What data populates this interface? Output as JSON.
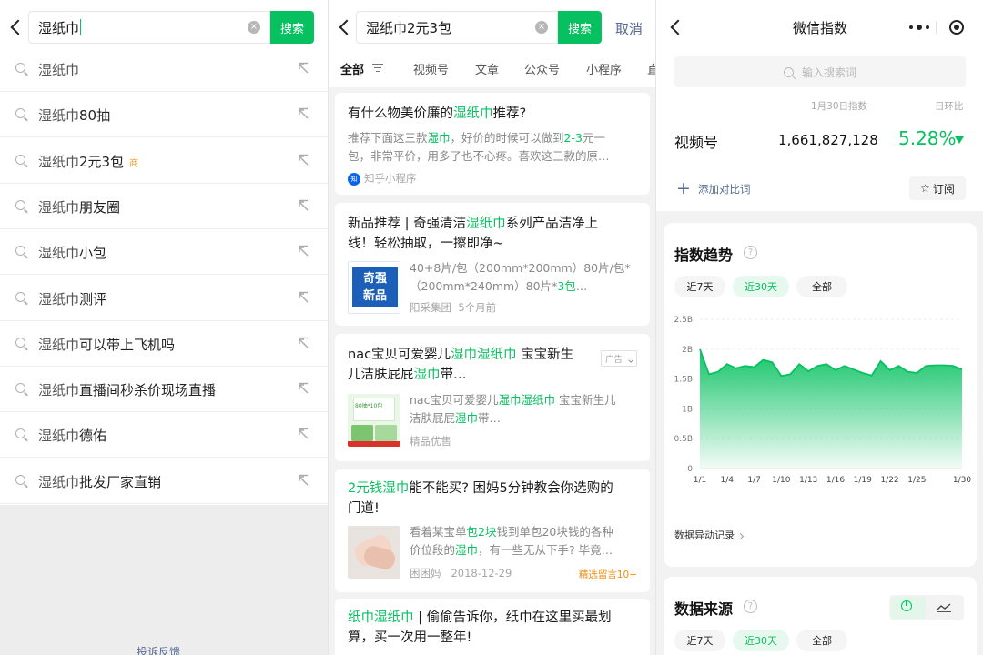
{
  "panel1": {
    "query": "湿纸巾",
    "search_btn": "搜索",
    "clear_icon": "×",
    "suggestions": [
      {
        "prefix": "湿纸巾",
        "rest": ""
      },
      {
        "prefix": "湿纸巾",
        "rest": "80抽"
      },
      {
        "prefix": "湿纸巾",
        "rest": "2元3包",
        "tag": "商"
      },
      {
        "prefix": "湿纸巾",
        "rest": "朋友圈"
      },
      {
        "prefix": "湿纸巾",
        "rest": "小包"
      },
      {
        "prefix": "湿纸巾",
        "rest": "测评"
      },
      {
        "prefix": "湿纸巾",
        "rest": "可以带上飞机吗"
      },
      {
        "prefix": "湿纸巾",
        "rest": "直播间秒杀价现场直播"
      },
      {
        "prefix": "湿纸巾",
        "rest": "德佑"
      },
      {
        "prefix": "湿纸巾",
        "rest": "批发厂家直销"
      }
    ],
    "feedback": "投诉反馈"
  },
  "panel2": {
    "query": "湿纸巾2元3包",
    "search_btn": "搜索",
    "cancel": "取消",
    "clear_icon": "×",
    "tabs": [
      "全部",
      "视频号",
      "文章",
      "公众号",
      "小程序",
      "直"
    ],
    "cards": [
      {
        "title_parts": [
          "有什么物美价廉的",
          "湿纸巾",
          "推荐?"
        ],
        "desc_parts": [
          "推荐下面这三款",
          "湿巾",
          "，好价的时候可以做到",
          "2-3",
          "元一"
        ],
        "desc_line2": "包，非常平价，用多了也不心疼。喜欢这三款的原…",
        "source_badge": "知",
        "source": "知乎小程序"
      },
      {
        "title_parts": [
          "新品推荐 | 奇强清洁",
          "湿纸巾",
          "系列产品洁净上"
        ],
        "title_line2": "线！轻松抽取，一擦即净~",
        "thumb_text": [
          "奇强",
          "新品"
        ],
        "desc_line1": "40+8片/包（200mm*200mm）80片/包*",
        "desc_parts2": [
          "（200mm*240mm）80片*",
          "3包",
          "…"
        ],
        "source": "阳采集团",
        "time": "5个月前"
      },
      {
        "title_parts": [
          "nac宝贝可爱婴儿",
          "湿巾湿纸巾",
          " 宝宝新生"
        ],
        "title_parts2": [
          "儿洁肤屁屁",
          "湿巾",
          "带…"
        ],
        "ad": "广告",
        "thumb_text": [
          "80抽*10包"
        ],
        "desc_parts": [
          "nac宝贝可爱婴儿",
          "湿巾湿纸巾",
          " 宝宝新生儿"
        ],
        "desc_parts2": [
          "洁肤屁屁",
          "湿巾",
          "带…"
        ],
        "source": "精品优售"
      },
      {
        "title_parts": [
          "2元钱湿巾",
          "能不能买? 困妈5分钟教会你选购的"
        ],
        "title_line2": "门道!",
        "desc_parts": [
          "看着某宝单",
          "包2块",
          "钱到单包20块钱的各种"
        ],
        "desc_parts2": [
          "价位段的",
          "湿巾",
          "，有一些无从下手? 毕竟…"
        ],
        "source": "困困妈",
        "time": "2018-12-29",
        "comment": "精选留言10+"
      },
      {
        "title_parts": [
          "纸巾湿纸巾",
          " | 偷偷告诉你，纸巾在这里买最划"
        ],
        "title_line2": "算，买一次用一整年!"
      }
    ]
  },
  "panel3": {
    "title": "微信指数",
    "search_placeholder": "输入搜索词",
    "date_label": "1月30日指数",
    "dod_label": "日环比",
    "metric_name": "视频号",
    "metric_value": "1,661,827,128",
    "metric_pct": "5.28%",
    "add_compare": "添加对比词",
    "subscribe": "订阅",
    "trend_title": "指数趋势",
    "ranges": [
      "近7天",
      "近30天",
      "全部"
    ],
    "anomaly": "数据异动记录",
    "source_title": "数据来源",
    "accent": "#07c160",
    "chart_data": {
      "type": "area",
      "x": [
        "1/1",
        "1/2",
        "1/3",
        "1/4",
        "1/5",
        "1/6",
        "1/7",
        "1/8",
        "1/9",
        "1/10",
        "1/11",
        "1/12",
        "1/13",
        "1/14",
        "1/15",
        "1/16",
        "1/17",
        "1/18",
        "1/19",
        "1/20",
        "1/21",
        "1/22",
        "1/23",
        "1/24",
        "1/25",
        "1/26",
        "1/27",
        "1/28",
        "1/29",
        "1/30"
      ],
      "series": [
        {
          "values": [
            2.0,
            1.58,
            1.62,
            1.75,
            1.68,
            1.72,
            1.7,
            1.82,
            1.78,
            1.55,
            1.58,
            1.75,
            1.63,
            1.72,
            1.75,
            1.65,
            1.72,
            1.66,
            1.6,
            1.56,
            1.8,
            1.65,
            1.72,
            1.62,
            1.6,
            1.72,
            1.73,
            1.73,
            1.72,
            1.66
          ]
        }
      ],
      "y_ticks": [
        "0",
        "0.5B",
        "1B",
        "1.5B",
        "2B",
        "2.5B"
      ],
      "x_ticks": [
        "1/1",
        "1/4",
        "1/7",
        "1/10",
        "1/13",
        "1/16",
        "1/19",
        "1/22",
        "1/25",
        "1/30"
      ],
      "ylim": [
        0,
        2.5
      ],
      "grid": true
    }
  }
}
